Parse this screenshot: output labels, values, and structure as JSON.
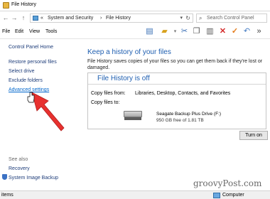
{
  "window": {
    "title": "File History"
  },
  "address": {
    "chevron": "«",
    "segment1": "System and Security",
    "separator": "›",
    "segment2": "File History",
    "search_placeholder": "Search Control Panel"
  },
  "menu": {
    "file": "File",
    "edit": "Edit",
    "view": "View",
    "tools": "Tools"
  },
  "sidebar": {
    "home": "Control Panel Home",
    "links": [
      "Restore personal files",
      "Select drive",
      "Exclude folders",
      "Advanced settings"
    ],
    "see_also_label": "See also",
    "see_also": [
      "Recovery",
      "System Image Backup"
    ]
  },
  "main": {
    "heading": "Keep a history of your files",
    "description": "File History saves copies of your files so you can get them back if they're lost or damaged.",
    "status_title": "File History is off",
    "copy_from_label": "Copy files from:",
    "copy_from_value": "Libraries, Desktop, Contacts, and Favorites",
    "copy_to_label": "Copy files to:",
    "drive_name": "Seagate Backup Plus Drive (F:)",
    "drive_free": "950 GB free of 1.81 TB",
    "turn_on_button": "Turn on"
  },
  "status": {
    "items": "items",
    "location": "Computer"
  },
  "watermark": "groovyPost.com",
  "colors": {
    "heading_blue": "#1e5eb0",
    "link_blue": "#1e3d7a",
    "arrow_red": "#e8312f"
  }
}
